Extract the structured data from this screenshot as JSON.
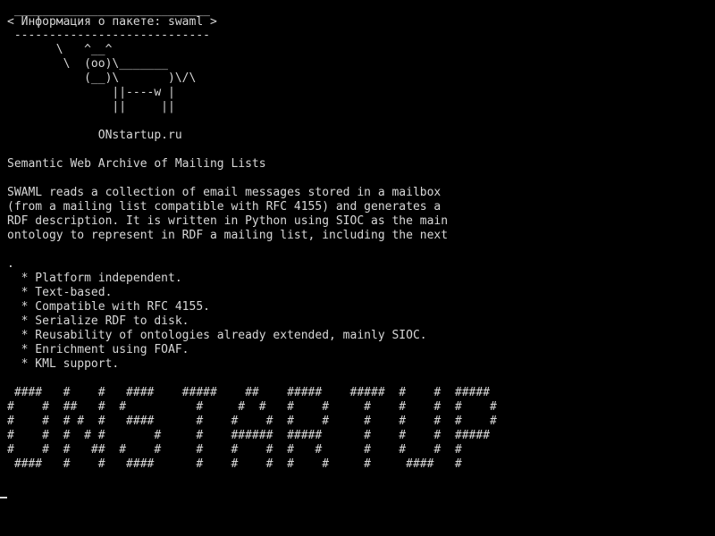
{
  "terminal": {
    "lines": [
      " ____________________________",
      "< Информация о пакете: swaml >",
      " ----------------------------",
      "       \\   ^__^",
      "        \\  (oo)\\_______",
      "           (__)\\       )\\/\\",
      "               ||----w |",
      "               ||     ||",
      "",
      "             ONstartup.ru",
      "",
      "Semantic Web Archive of Mailing Lists",
      "",
      "SWAML reads a collection of email messages stored in a mailbox",
      "(from a mailing list compatible with RFC 4155) and generates a",
      "RDF description. It is written in Python using SIOC as the main",
      "ontology to represent in RDF a mailing list, including the next",
      "",
      ".",
      "  * Platform independent.",
      "  * Text-based.",
      "  * Compatible with RFC 4155.",
      "  * Serialize RDF to disk.",
      "  * Reusability of ontologies already extended, mainly SIOC.",
      "  * Enrichment using FOAF.",
      "  * KML support.",
      "",
      " ####   #    #   ####    #####    ##    #####    #####  #    #  #####",
      "#    #  ##   #  #          #     #  #   #    #     #    #    #  #    #",
      "#    #  # #  #   ####      #    #    #  #    #     #    #    #  #    #",
      "#    #  #  # #       #     #    ######  #####      #    #    #  #####",
      "#    #  #   ##  #    #     #    #    #  #   #      #    #    #  #",
      " ####   #    #   ####      #    #    #  #    #     #     ####   #"
    ]
  }
}
